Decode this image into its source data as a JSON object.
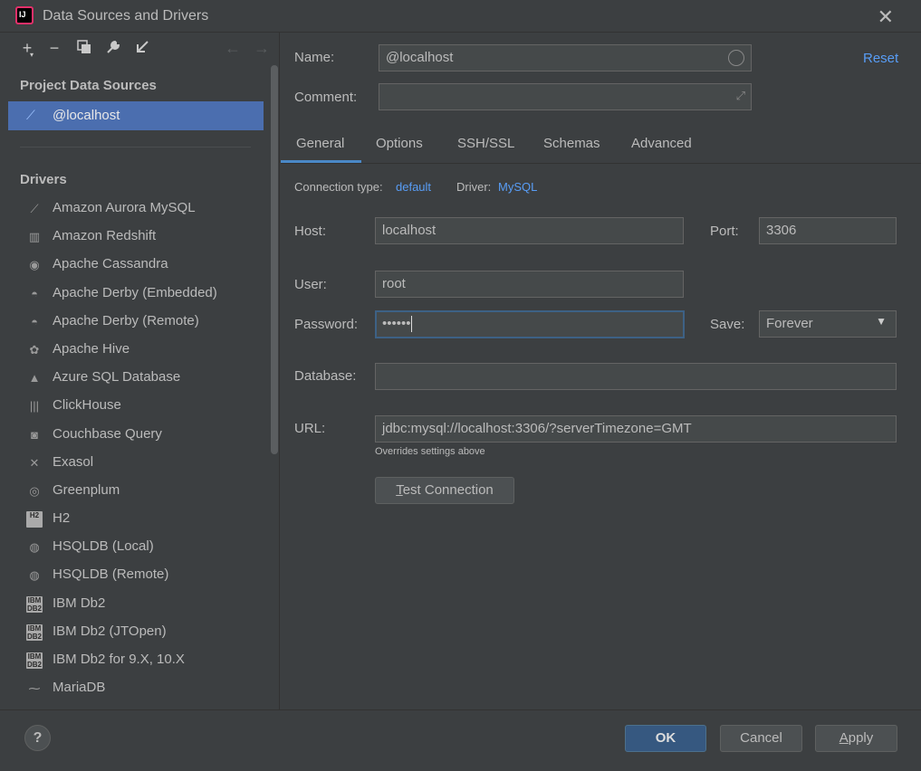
{
  "window": {
    "title": "Data Sources and Drivers"
  },
  "left_panel": {
    "project_title": "Project Data Sources",
    "selected_source": "@localhost",
    "drivers_title": "Drivers",
    "drivers": [
      {
        "label": "Amazon Aurora MySQL",
        "icon": "mysql-dolphin-icon"
      },
      {
        "label": "Amazon Redshift",
        "icon": "redshift-icon"
      },
      {
        "label": "Apache Cassandra",
        "icon": "cassandra-eye-icon"
      },
      {
        "label": "Apache Derby (Embedded)",
        "icon": "derby-hat-icon"
      },
      {
        "label": "Apache Derby (Remote)",
        "icon": "derby-hat-icon"
      },
      {
        "label": "Apache Hive",
        "icon": "hive-bee-icon"
      },
      {
        "label": "Azure SQL Database",
        "icon": "azure-icon"
      },
      {
        "label": "ClickHouse",
        "icon": "clickhouse-bars-icon"
      },
      {
        "label": "Couchbase Query",
        "icon": "couchbase-icon"
      },
      {
        "label": "Exasol",
        "icon": "exasol-x-icon"
      },
      {
        "label": "Greenplum",
        "icon": "greenplum-icon"
      },
      {
        "label": "H2",
        "icon": "h2-icon",
        "badge": "H2"
      },
      {
        "label": "HSQLDB (Local)",
        "icon": "hsqldb-icon"
      },
      {
        "label": "HSQLDB (Remote)",
        "icon": "hsqldb-icon"
      },
      {
        "label": "IBM Db2",
        "icon": "ibm-db2-icon",
        "badge": "IBM DB2"
      },
      {
        "label": "IBM Db2 (JTOpen)",
        "icon": "ibm-db2-icon",
        "badge": "IBM DB2"
      },
      {
        "label": "IBM Db2 for 9.X, 10.X",
        "icon": "ibm-db2-icon",
        "badge": "IBM DB2"
      },
      {
        "label": "MariaDB",
        "icon": "mariadb-seal-icon"
      }
    ]
  },
  "form": {
    "name_label": "Name:",
    "name_value": "@localhost",
    "reset_label": "Reset",
    "comment_label": "Comment:",
    "comment_value": "",
    "tabs": [
      "General",
      "Options",
      "SSH/SSL",
      "Schemas",
      "Advanced"
    ],
    "active_tab": "General",
    "connection_type_label": "Connection type:",
    "connection_type_value": "default",
    "driver_label": "Driver:",
    "driver_value": "MySQL",
    "host_label": "Host:",
    "host_value": "localhost",
    "port_label": "Port:",
    "port_value": "3306",
    "user_label": "User:",
    "user_value": "root",
    "password_label": "Password:",
    "password_value": "••••••",
    "save_label": "Save:",
    "save_value": "Forever",
    "database_label": "Database:",
    "database_value": "",
    "url_label": "URL:",
    "url_value": "jdbc:mysql://localhost:3306/?serverTimezone=GMT",
    "url_hint": "Overrides settings above",
    "test_connection_first": "T",
    "test_connection_rest": "est Connection"
  },
  "footer": {
    "help_label": "?",
    "ok_label": "OK",
    "cancel_label": "Cancel",
    "apply_first": "A",
    "apply_rest": "pply"
  },
  "colors": {
    "background": "#3c3f41",
    "selection": "#4b6eaf",
    "link": "#589df6",
    "tab_underline": "#4a88c7",
    "primary_button": "#365880"
  }
}
